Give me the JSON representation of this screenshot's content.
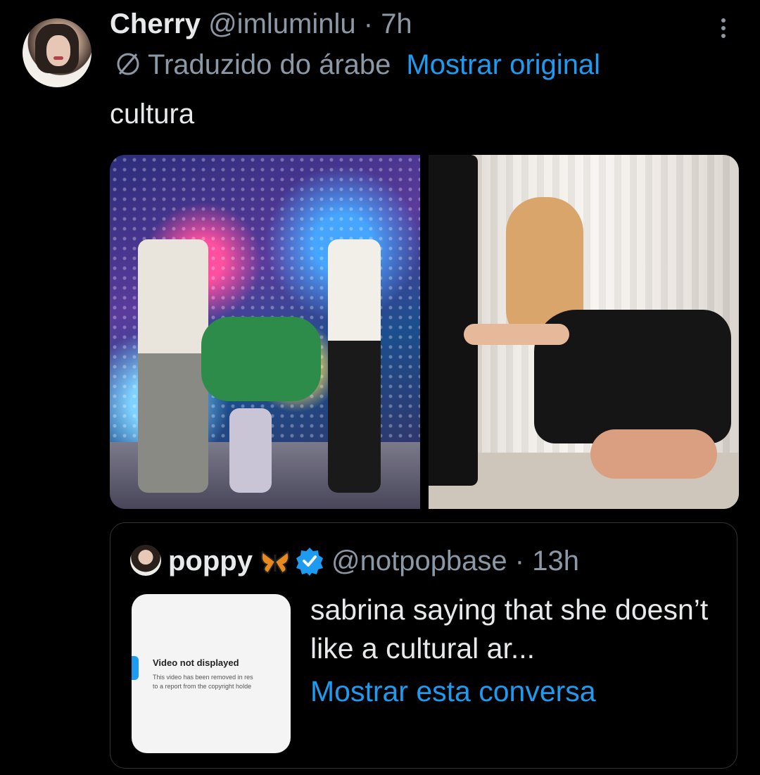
{
  "tweet": {
    "author_name": "Cherry",
    "author_handle": "@imluminlu",
    "separator": "·",
    "time": "7h",
    "translation_label": "Traduzido do árabe",
    "show_original": "Mostrar original",
    "text": "cultura"
  },
  "quoted_tweet": {
    "author_name": "poppy",
    "author_handle": "@notpopbase",
    "separator": "·",
    "time": "13h",
    "thumbnail_title": "Video not displayed",
    "thumbnail_line1": "This video has been removed in res",
    "thumbnail_line2": "to a report from the copyright holde",
    "text": "sabrina saying that she doesn’t like a cultural ar...",
    "show_conversation": "Mostrar esta conversa"
  },
  "colors": {
    "background": "#000000",
    "primary_text": "#e7e9ea",
    "secondary_text": "#8b98a5",
    "link": "#1d9bf0",
    "border": "#2f3336"
  },
  "icons": [
    "avatar",
    "more-options-icon",
    "translate-icon",
    "butterfly-emoji-icon",
    "verified-badge-icon",
    "video-icon"
  ]
}
